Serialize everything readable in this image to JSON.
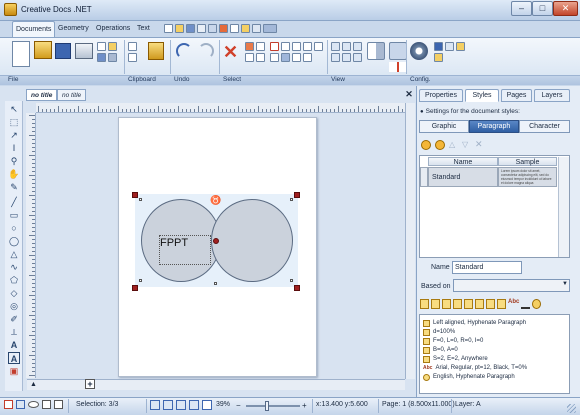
{
  "app": {
    "title": "Creative Docs .NET"
  },
  "ribbon": {
    "tabs": [
      "Documents",
      "Geometry",
      "Operations",
      "Text"
    ],
    "groups": {
      "file": "File",
      "clipboard": "Clipboard",
      "undo": "Undo",
      "select": "Select",
      "view": "View",
      "config": "Config."
    }
  },
  "document": {
    "tabs": [
      "no title",
      "no title"
    ],
    "shape_text": "FPPT"
  },
  "panel": {
    "tabs": [
      "Properties",
      "Styles",
      "Pages",
      "Layers"
    ],
    "heading": "Settings for the document styles:",
    "subtabs": [
      "Graphic",
      "Paragraph",
      "Character"
    ],
    "table": {
      "columns": [
        "Name",
        "Sample"
      ],
      "rows": [
        {
          "name": "Standard",
          "sample": "Lorem ipsum dolor sit amet, consectetur adipiscing elit, sed do eiusmod tempor incididunt ut labore et dolore magna aliqua"
        }
      ]
    },
    "name_label": "Name",
    "name_value": "Standard",
    "based_on_label": "Based on",
    "properties": [
      "Left aligned, Hyphenate Paragraph",
      "d=100%",
      "F=0, L=0, R=0, I=0",
      "B=0, A=0",
      "S=2, E=2, Anywhere",
      "Arial, Regular, pt=12, Black, T=0%",
      "English, Hyphenate Paragraph"
    ]
  },
  "status": {
    "selection": "Selection: 3/3",
    "zoom": "39%",
    "coords": "x:13.400 y:5.600",
    "page": "Page: 1 (8.500x11.000)",
    "layer": "Layer: A"
  },
  "colors": {
    "accent": "#2f5fa3",
    "handle": "#a02020",
    "shape_fill": "#cbd2dc"
  }
}
